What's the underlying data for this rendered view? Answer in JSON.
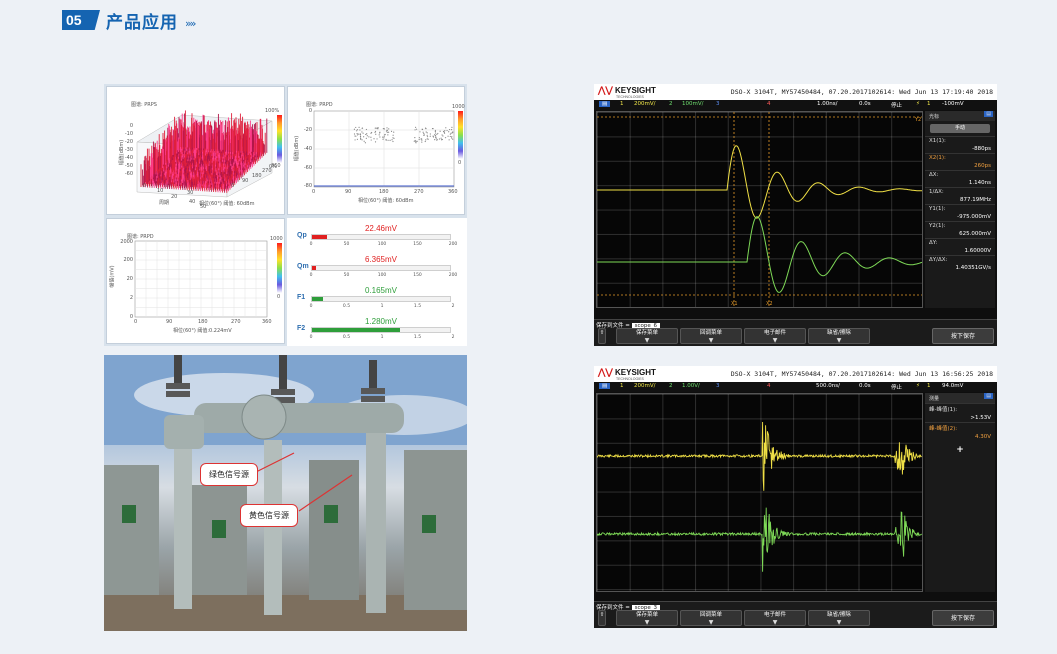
{
  "section": {
    "number": "05",
    "title": "产品应用",
    "arrow": "»»"
  },
  "pd_software": {
    "prps_caption": "图谱: PRPS",
    "prps_ylabel": "幅值(dBm)",
    "prps_xlabel": "相位(60°)  阈值: 60dBm",
    "prps_period_label": "周期",
    "prps_colorbar": [
      "100%",
      "0%"
    ],
    "prps_yticks": [
      "0",
      "-10",
      "-20",
      "-30",
      "-40",
      "-50",
      "-60"
    ],
    "prps_xticks": [
      "0",
      "10",
      "20",
      "30",
      "40",
      "50"
    ],
    "prps_phase_ticks": [
      "0",
      "90",
      "180",
      "270",
      "360"
    ],
    "prpd_caption": "图谱: PRPD",
    "prpd_ylabel": "幅值(dBm)",
    "prpd_xlabel": "相位(60°)  阈值: 60dBm",
    "prpd_colorbar": [
      "1000",
      "0"
    ],
    "prpd_yticks": [
      "0",
      "-20",
      "-40",
      "-60",
      "-80"
    ],
    "prpd_xticks": [
      "0",
      "90",
      "180",
      "270",
      "360"
    ],
    "prpd2_caption": "图谱: PRPD",
    "prpd2_ylabel": "幅值(mV)",
    "prpd2_xlabel": "相位(60°)  阈值:0.224mV",
    "prpd2_colorbar": [
      "1000",
      "0"
    ],
    "prpd2_yticks": [
      "2000",
      "200",
      "20",
      "2",
      "0"
    ],
    "prpd2_xticks": [
      "0",
      "90",
      "180",
      "270",
      "360"
    ],
    "gauges": [
      {
        "name": "Qp",
        "value": "22.46mV",
        "color": "#e02020",
        "fraction": 0.11,
        "ticks": [
          "0",
          "50",
          "100",
          "150",
          "200"
        ]
      },
      {
        "name": "Qm",
        "value": "6.365mV",
        "color": "#e02020",
        "fraction": 0.03,
        "ticks": [
          "0",
          "50",
          "100",
          "150",
          "200"
        ]
      },
      {
        "name": "F1",
        "value": "0.165mV",
        "color": "#2e9e3a",
        "fraction": 0.08,
        "ticks": [
          "0",
          "0.5",
          "1",
          "1.5",
          "2"
        ]
      },
      {
        "name": "F2",
        "value": "1.280mV",
        "color": "#2e9e3a",
        "fraction": 0.64,
        "ticks": [
          "0",
          "0.5",
          "1",
          "1.5",
          "2"
        ]
      }
    ]
  },
  "photo": {
    "callout_green": "绿色信号源",
    "callout_yellow": "黄色信号源"
  },
  "scope1": {
    "brand": "KEYSIGHT",
    "brand_sub": "TECHNOLOGIES",
    "model_line": "DSO-X 3104T, MY57450484, 07.20.2017102614: Wed Jun 13 17:19:40 2018",
    "bar": {
      "ch1": "1",
      "ch1_scale": "200mV/",
      "ch2": "2",
      "ch2_scale": "100mV/",
      "ch3": "3",
      "ch4": "4",
      "timebase": "1.00ns/",
      "delay": "0.0s",
      "state": "停止",
      "trig_ch": "1",
      "trig_level": "-100mV"
    },
    "side_title": "光标",
    "side_button": "手动",
    "readouts": [
      {
        "label": "X1(1):",
        "value": "-880ps"
      },
      {
        "label": "X2(1):",
        "value": "260ps"
      },
      {
        "label": "ΔX:",
        "value": "1.140ns"
      },
      {
        "label": "1/ΔX:",
        "value": "877.19MHz"
      },
      {
        "label": "Y1(1):",
        "value": "-975.000mV"
      },
      {
        "label": "Y2(1):",
        "value": "625.000mV"
      },
      {
        "label": "ΔY:",
        "value": "1.60000V"
      },
      {
        "label": "ΔY/ΔX:",
        "value": "1.40351GV/s"
      }
    ],
    "markers": [
      "X1",
      "X2",
      "Y2"
    ],
    "save_to": "保存到文件 =",
    "filename": "scope_6",
    "softkeys": [
      "保存菜单",
      "回调菜单",
      "电子邮件",
      "缺省/擦除"
    ],
    "press_save": "按下保存"
  },
  "scope2": {
    "brand": "KEYSIGHT",
    "brand_sub": "TECHNOLOGIES",
    "model_line": "DSO-X 3104T, MY57450484, 07.20.2017102614: Wed Jun 13 16:56:25 2018",
    "bar": {
      "ch1": "1",
      "ch1_scale": "200mV/",
      "ch2": "2",
      "ch2_scale": "1.00V/",
      "ch3": "3",
      "ch4": "4",
      "timebase": "500.0ns/",
      "delay": "0.0s",
      "state": "停止",
      "trig_ch": "1",
      "trig_level": "94.0mV"
    },
    "side_title": "测量",
    "readouts": [
      {
        "label": "峰-峰值(1):",
        "value": ">1.53V"
      },
      {
        "label": "峰-峰值(2):",
        "value": "4.30V"
      }
    ],
    "add": "+",
    "save_to": "保存到文件 =",
    "filename": "scope_3",
    "softkeys": [
      "保存菜单",
      "回调菜单",
      "电子邮件",
      "缺省/擦除"
    ],
    "press_save": "按下保存"
  }
}
